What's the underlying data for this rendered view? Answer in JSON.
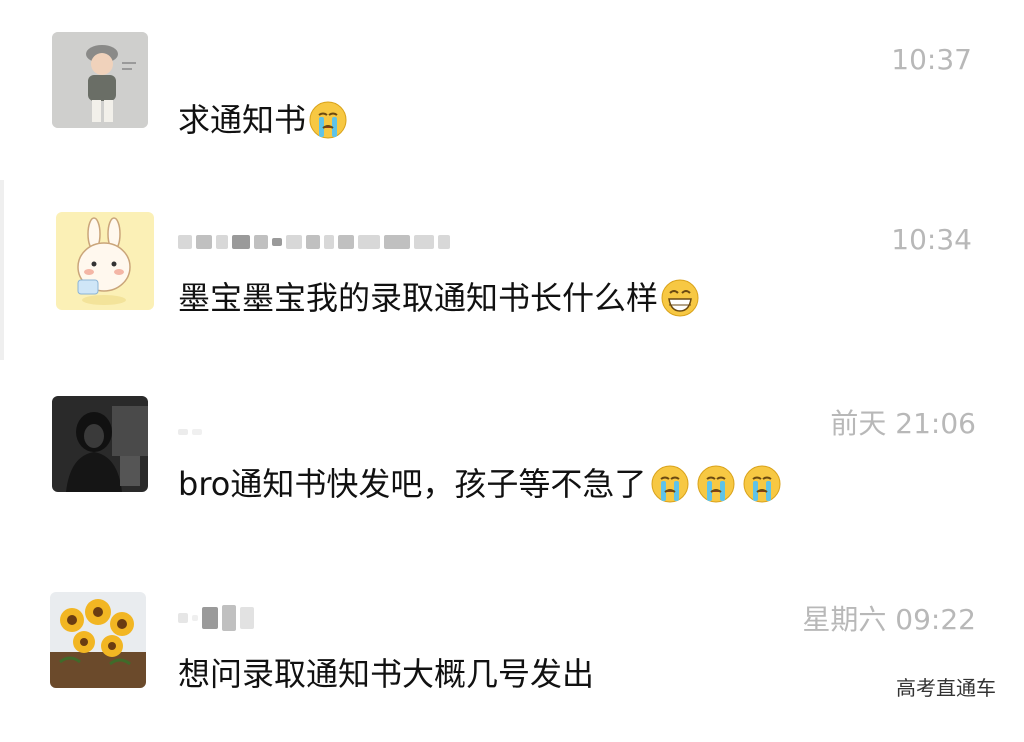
{
  "messages": [
    {
      "time": "10:37",
      "text": "求通知书",
      "emojis": [
        "crying-face"
      ],
      "avatar": "boy-avatar"
    },
    {
      "time": "10:34",
      "text": "墨宝墨宝我的录取通知书长什么样",
      "emojis": [
        "grinning-face"
      ],
      "avatar": "bunny-avatar"
    },
    {
      "time": "前天 21:06",
      "text": "bro通知书快发吧，孩子等不急了",
      "emojis": [
        "crying-face",
        "crying-face",
        "crying-face"
      ],
      "avatar": "dark-hoodie-avatar"
    },
    {
      "time": "星期六 09:22",
      "text": "想问录取通知书大概几号发出",
      "emojis": [],
      "avatar": "sunflower-avatar"
    }
  ],
  "watermark": "高考直通车",
  "colors": {
    "time_gray": "#b8b8b8",
    "text": "#111111",
    "emoji_yellow": "#f7c843",
    "tear_blue": "#5fc3e8"
  }
}
